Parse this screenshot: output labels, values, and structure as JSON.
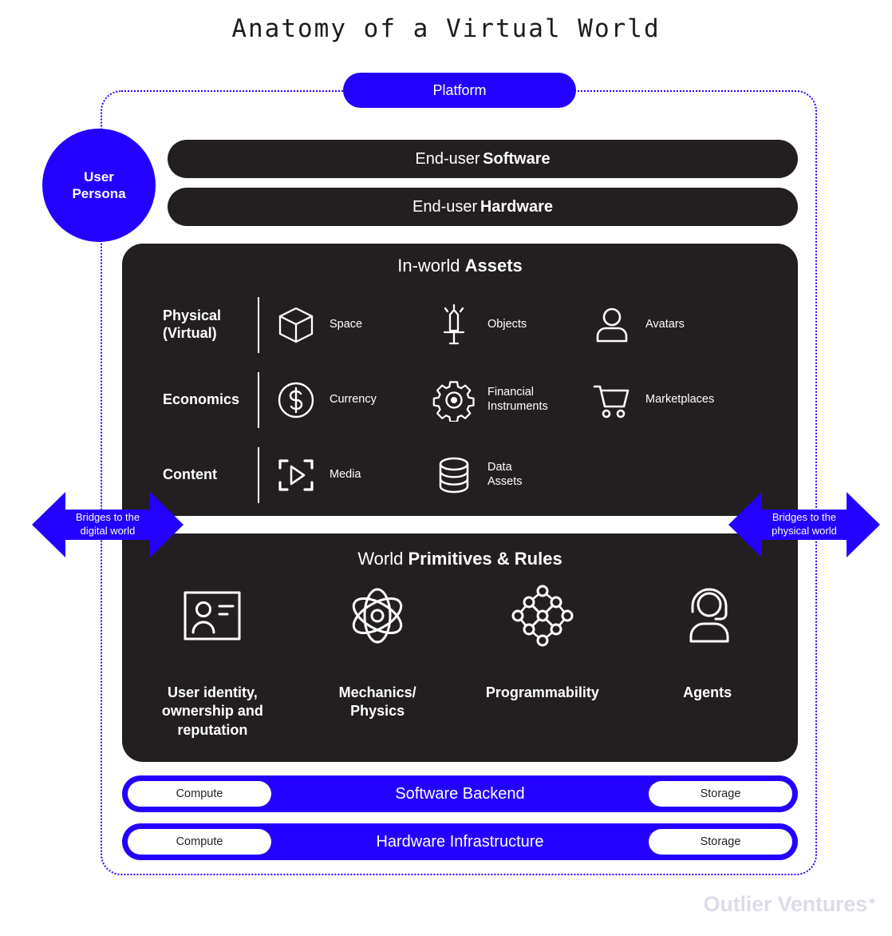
{
  "title": "Anatomy of a Virtual World",
  "colors": {
    "accent_blue": "#2400ff",
    "panel_dark": "#231f20",
    "background": "#ffffff",
    "logo_grey": "#dcdce8"
  },
  "platform": {
    "label": "Platform"
  },
  "user_persona": {
    "label": "User\nPersona"
  },
  "end_user_bars": [
    {
      "prefix": "End-user",
      "emphasis": "Software"
    },
    {
      "prefix": "End-user",
      "emphasis": "Hardware"
    }
  ],
  "assets": {
    "title_prefix": "In-world",
    "title_emphasis": "Assets",
    "rows": [
      {
        "label": "Physical\n(Virtual)",
        "items": [
          {
            "label": "Space",
            "icon": "cube-icon"
          },
          {
            "label": "Objects",
            "icon": "sword-icon"
          },
          {
            "label": "Avatars",
            "icon": "person-icon"
          }
        ]
      },
      {
        "label": "Economics",
        "items": [
          {
            "label": "Currency",
            "icon": "dollar-circle-icon"
          },
          {
            "label": "Financial\nInstruments",
            "icon": "gear-icon"
          },
          {
            "label": "Marketplaces",
            "icon": "shopping-cart-icon"
          }
        ]
      },
      {
        "label": "Content",
        "items": [
          {
            "label": "Media",
            "icon": "media-play-icon"
          },
          {
            "label": "Data\nAssets",
            "icon": "database-icon"
          }
        ]
      }
    ]
  },
  "primitives": {
    "title_prefix": "World",
    "title_emphasis": "Primitives & Rules",
    "items": [
      {
        "label": "User identity,\nownership and\nreputation",
        "icon": "id-card-icon"
      },
      {
        "label": "Mechanics/\nPhysics",
        "icon": "atom-icon"
      },
      {
        "label": "Programmability",
        "icon": "node-network-icon"
      },
      {
        "label": "Agents",
        "icon": "headset-agent-icon"
      }
    ]
  },
  "bridges": [
    {
      "label": "Bridges to the\ndigital world",
      "side": "left"
    },
    {
      "label": "Bridges to the\nphysical world",
      "side": "right"
    }
  ],
  "infrastructure": [
    {
      "title": "Software Backend",
      "left_chip": "Compute",
      "right_chip": "Storage"
    },
    {
      "title": "Hardware Infrastructure",
      "left_chip": "Compute",
      "right_chip": "Storage"
    }
  ],
  "brand": {
    "name": "Outlier Ventures"
  }
}
